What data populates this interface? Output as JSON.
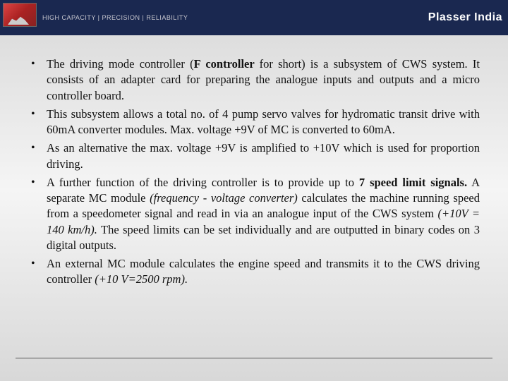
{
  "header": {
    "tagline": "HIGH CAPACITY | PRECISION | RELIABILITY",
    "brand": "Plasser India"
  },
  "bullets": [
    {
      "pre": "The driving mode controller (",
      "bold1": "F controller ",
      "post1": "for short) is a subsystem of CWS system. It consists of an adapter card for preparing the analogue inputs and outputs and a micro controller board."
    },
    {
      "text": "This subsystem allows a total no. of 4 pump servo valves for hydromatic transit drive with 60mA converter modules. Max. voltage +9V of MC is converted to 60mA."
    },
    {
      "text": "As an alternative the max. voltage +9V is amplified to +10V which is used for proportion driving."
    },
    {
      "pre": "A further function of the driving controller is to provide up to ",
      "bold1": "7 speed limit signals.",
      "mid1": " A separate MC module ",
      "ital1": "(frequency - voltage converter)",
      "mid2": " calculates the machine running speed from a speedometer signal and read in via an analogue input of the CWS system ",
      "ital2": "(+10V = 140 km/h).",
      "post2": " The speed limits can be set individually and are outputted in binary codes on 3 digital outputs."
    },
    {
      "pre": "An external MC module calculates the engine speed and transmits it to the CWS driving controller ",
      "ital1": "(+10 V=2500 rpm)."
    }
  ]
}
